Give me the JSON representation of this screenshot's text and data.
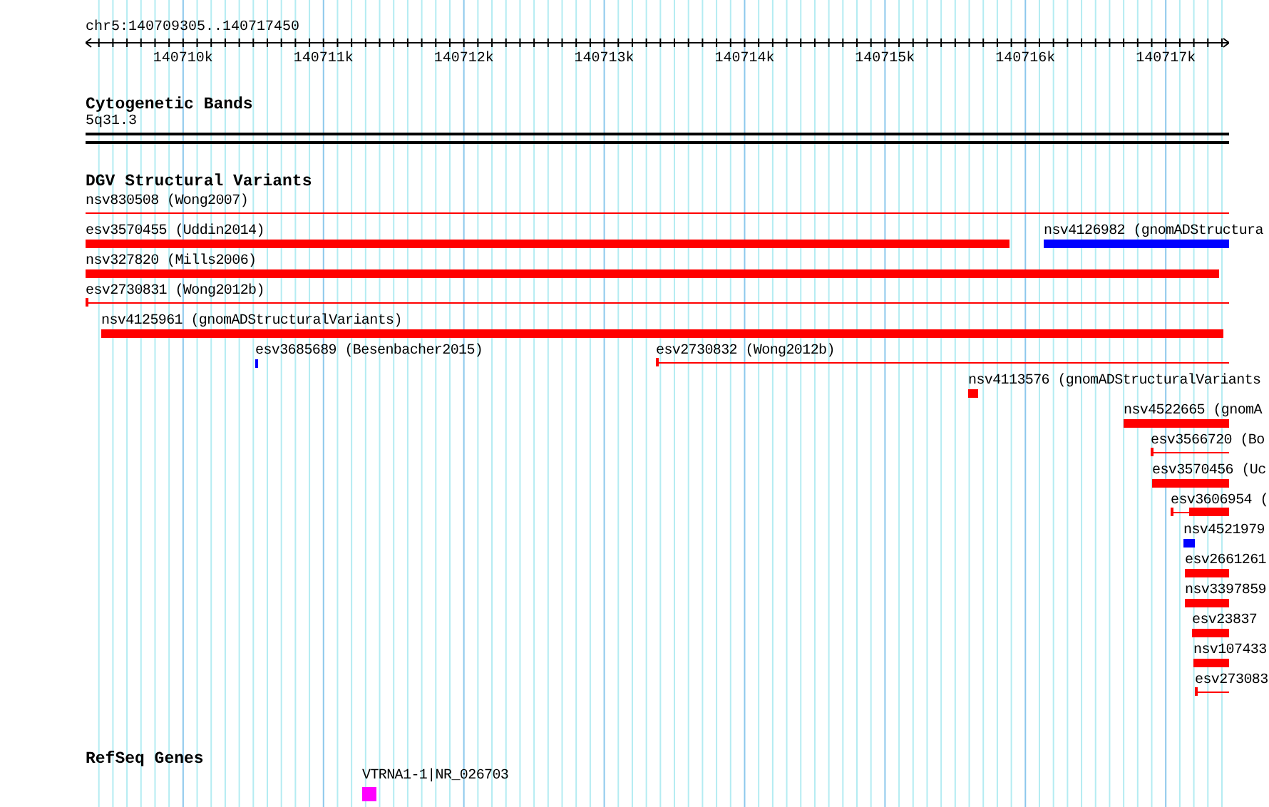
{
  "ruler": {
    "region": "chr5:140709305..140717450",
    "ticks": [
      "140710k",
      "140711k",
      "140712k",
      "140713k",
      "140714k",
      "140715k",
      "140716k",
      "140717k"
    ]
  },
  "tracks": [
    {
      "kind": "bands",
      "title": "Cytogenetic Bands",
      "features": [
        {
          "label": "5q31.3",
          "kind": "band",
          "color": "#000000"
        }
      ]
    },
    {
      "kind": "variants",
      "title": "DGV Structural Variants",
      "features": [
        {
          "label": "nsv830508 (Wong2007)",
          "kind": "line",
          "color": "#ff0000"
        },
        {
          "label": "esv3570455 (Uddin2014)",
          "kind": "bar",
          "color": "#ff0000"
        },
        {
          "label": "nsv4126982 (gnomADStructura",
          "kind": "bar",
          "color": "#0000ff"
        },
        {
          "label": "nsv327820 (Mills2006)",
          "kind": "bar",
          "color": "#ff0000"
        },
        {
          "label": "esv2730831 (Wong2012b)",
          "kind": "line",
          "color": "#ff0000"
        },
        {
          "label": "nsv4125961 (gnomADStructuralVariants)",
          "kind": "bar",
          "color": "#ff0000"
        },
        {
          "label": "esv3685689 (Besenbacher2015)",
          "kind": "bar",
          "color": "#0000ff"
        },
        {
          "label": "esv2730832 (Wong2012b)",
          "kind": "line",
          "color": "#ff0000"
        },
        {
          "label": "nsv4113576 (gnomADStructuralVariants",
          "kind": "bar",
          "color": "#ff0000"
        },
        {
          "label": "nsv4522665 (gnomA",
          "kind": "bar",
          "color": "#ff0000"
        },
        {
          "label": "esv3566720 (Bo",
          "kind": "line",
          "color": "#ff0000"
        },
        {
          "label": "esv3570456 (Uc",
          "kind": "bar",
          "color": "#ff0000"
        },
        {
          "label": "esv3606954 (",
          "kind": "gapped",
          "color": "#ff0000"
        },
        {
          "label": "nsv4521979",
          "kind": "bar",
          "color": "#0000ff"
        },
        {
          "label": "esv2661261",
          "kind": "bar",
          "color": "#ff0000"
        },
        {
          "label": "nsv3397859",
          "kind": "bar",
          "color": "#ff0000"
        },
        {
          "label": "esv23837",
          "kind": "bar",
          "color": "#ff0000"
        },
        {
          "label": "nsv107433",
          "kind": "bar",
          "color": "#ff0000"
        },
        {
          "label": "esv273083",
          "kind": "line",
          "color": "#ff0000"
        }
      ]
    },
    {
      "kind": "genes",
      "title": "RefSeq Genes",
      "features": [
        {
          "label": "VTRNA1-1|NR_026703",
          "kind": "box",
          "color": "#ff00ff"
        }
      ]
    }
  ]
}
